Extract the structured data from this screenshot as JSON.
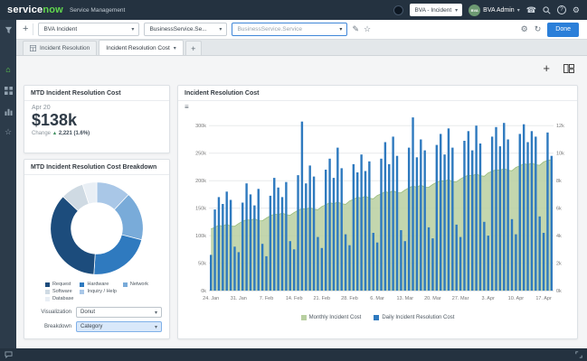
{
  "header": {
    "logo_service": "service",
    "logo_now": "now",
    "subtitle": "Service Management",
    "scope_select": "BVA - Incident",
    "user": {
      "initials": "BVA",
      "name": "BVA Admin"
    }
  },
  "glyphs": {
    "caret": "▾",
    "plus": "+",
    "phone": "☎",
    "gear": "⚙",
    "pencil": "✎",
    "star": "☆",
    "refresh": "↻",
    "home": "⌂",
    "hamburger": "≡",
    "help": "?",
    "up_arrow": "▲"
  },
  "toolbar": {
    "dashboard_select": "BVA Incident",
    "breakdown_source_select": "BusinessService.Se...",
    "filter_input": "BusinessService.Service",
    "done_label": "Done"
  },
  "tabs": {
    "tab1": "Incident Resolution",
    "tab2": "Incident Resolution Cost"
  },
  "kpi": {
    "title": "MTD Incident Resolution Cost",
    "date": "Apr 20",
    "value": "$138k",
    "change_label": "Change",
    "change_value": "2,221 (1.6%)"
  },
  "breakdown_controls": {
    "visualization_label": "Visualization",
    "visualization_value": "Donut",
    "breakdown_label": "Breakdown",
    "breakdown_value": "Category"
  },
  "chart_data": [
    {
      "type": "pie",
      "title": "MTD Incident Resolution Cost Breakdown",
      "donut": true,
      "slices": [
        {
          "label": "Inquiry / Help",
          "value": 12,
          "color": "#a9c7e7"
        },
        {
          "label": "Network",
          "value": 17,
          "color": "#79abd9"
        },
        {
          "label": "Hardware",
          "value": 22,
          "color": "#2f7abf"
        },
        {
          "label": "Request",
          "value": 36,
          "color": "#1c4c7c"
        },
        {
          "label": "Software",
          "value": 8,
          "color": "#cfdae3"
        },
        {
          "label": "Database",
          "value": 5,
          "color": "#e9eff5"
        }
      ],
      "legend_order": [
        "Request",
        "Hardware",
        "Network",
        "Software",
        "Inquiry / Help",
        "Database"
      ]
    },
    {
      "type": "combo",
      "title": "Incident Resolution Cost",
      "x_tick_labels": [
        "24. Jan",
        "31. Jan",
        "7. Feb",
        "14. Feb",
        "21. Feb",
        "28. Feb",
        "6. Mar",
        "13. Mar",
        "20. Mar",
        "27. Mar",
        "3. Apr",
        "10. Apr",
        "17. Apr"
      ],
      "x_tick_every": 7,
      "left_axis": {
        "max": 325000,
        "tick_labels": [
          "0k",
          "50k",
          "100k",
          "150k",
          "200k",
          "250k",
          "300k"
        ]
      },
      "right_axis": {
        "max": 13000,
        "tick_labels": [
          "0k",
          "2k",
          "4k",
          "6k",
          "8k",
          "10k",
          "12k"
        ]
      },
      "legend_position": "bottom",
      "grid": true,
      "series": [
        {
          "name": "Monthly Incident Cost",
          "type": "area",
          "axis": "left",
          "color": "#b8cfa0",
          "stroke": "#9abd7c",
          "values": [
            112000,
            115000,
            119000,
            117000,
            121000,
            117000,
            117000,
            122000,
            126000,
            129000,
            128000,
            131000,
            127000,
            127000,
            132000,
            136000,
            139000,
            138000,
            141000,
            138000,
            137000,
            142000,
            146000,
            149000,
            148000,
            151000,
            148000,
            147000,
            153000,
            156000,
            160000,
            158000,
            161000,
            158000,
            157000,
            163000,
            166000,
            170000,
            168000,
            172000,
            168000,
            167000,
            173000,
            176000,
            180000,
            178000,
            182000,
            178000,
            178000,
            183000,
            187000,
            190000,
            188000,
            192000,
            188000,
            188000,
            193000,
            197000,
            200000,
            199000,
            202000,
            198000,
            198000,
            203000,
            207000,
            210000,
            209000,
            212000,
            209000,
            208000,
            214000,
            217000,
            220000,
            219000,
            222000,
            219000,
            218000,
            224000,
            227000,
            231000,
            229000,
            232000,
            229000,
            228000,
            234000,
            237000,
            238000
          ]
        },
        {
          "name": "Daily Incident Resolution Cost",
          "type": "bar",
          "axis": "right",
          "color": "#2f7abf",
          "values": [
            2600,
            5900,
            6800,
            6300,
            7200,
            6600,
            3200,
            2800,
            6400,
            7800,
            7000,
            6200,
            7400,
            3400,
            2500,
            6900,
            8200,
            7500,
            6800,
            7900,
            3600,
            3000,
            8400,
            12300,
            7800,
            9100,
            8300,
            3900,
            3100,
            8800,
            9600,
            8200,
            10400,
            8900,
            4100,
            3300,
            9200,
            8600,
            9900,
            8700,
            9400,
            4200,
            3500,
            9600,
            10800,
            9200,
            11200,
            9800,
            4400,
            3600,
            10400,
            12600,
            9700,
            11000,
            10200,
            4600,
            3800,
            10600,
            11400,
            9900,
            11800,
            10400,
            4800,
            3900,
            10900,
            11600,
            10200,
            12000,
            10700,
            5000,
            4000,
            11200,
            11900,
            10500,
            12200,
            11000,
            5200,
            4100,
            11400,
            12100,
            10800,
            11600,
            11200,
            5400,
            4200,
            11500,
            9800
          ]
        }
      ]
    }
  ]
}
